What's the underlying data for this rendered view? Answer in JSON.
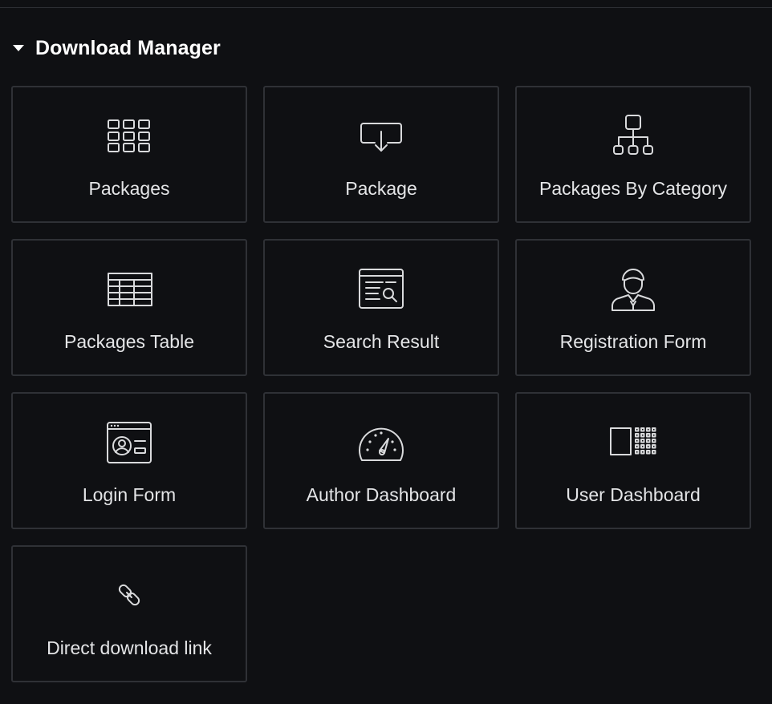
{
  "section": {
    "title": "Download Manager",
    "caret_icon": "caret-down-icon"
  },
  "widgets": [
    {
      "label": "Packages",
      "icon": "grid-icon"
    },
    {
      "label": "Package",
      "icon": "download-box-icon"
    },
    {
      "label": "Packages By Category",
      "icon": "hierarchy-icon"
    },
    {
      "label": "Packages Table",
      "icon": "table-icon"
    },
    {
      "label": "Search Result",
      "icon": "search-document-icon"
    },
    {
      "label": "Registration Form",
      "icon": "user-person-icon"
    },
    {
      "label": "Login Form",
      "icon": "login-card-icon"
    },
    {
      "label": "Author Dashboard",
      "icon": "gauge-icon"
    },
    {
      "label": "User Dashboard",
      "icon": "dashboard-panel-icon"
    },
    {
      "label": "Direct download link",
      "icon": "link-icon"
    }
  ],
  "colors": {
    "background": "#0f1013",
    "tile_border": "#2f3136",
    "text": "#e4e5e7",
    "icon": "#d9dadc"
  }
}
